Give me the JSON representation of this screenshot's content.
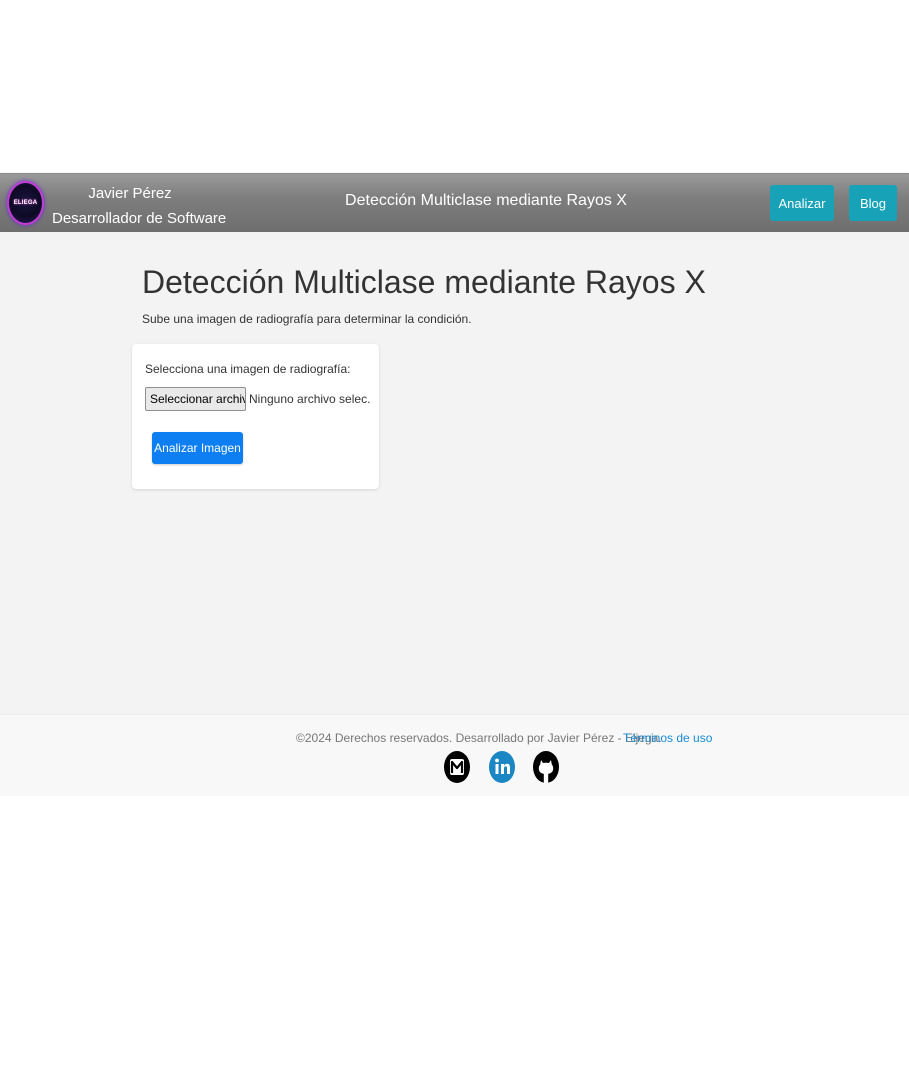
{
  "header": {
    "logo_text": "ELIEGA",
    "brand_name": "Javier Pérez",
    "brand_role": "Desarrollador de Software",
    "title": "Detección Multiclase mediante Rayos X",
    "buttons": {
      "analizar": "Analizar",
      "blog": "Blog"
    },
    "button_color": "#17a2b8"
  },
  "main": {
    "title": "Detección Multiclase mediante Rayos X",
    "subtitle": "Sube una imagen de radiografía para determinar la condición.",
    "form": {
      "label": "Selecciona una imagen de radiografía:",
      "file_button": "Seleccionar archivo",
      "file_status": "Ninguno archivo selec.",
      "submit": "Analizar Imagen",
      "submit_color": "#0d7ff2"
    }
  },
  "footer": {
    "copyright": "©2024 Derechos reservados. Desarrollado por Javier Pérez - Eljega.",
    "terms_link": "Términos de uso",
    "social": [
      {
        "icon": "mail-icon"
      },
      {
        "icon": "linkedin-icon"
      },
      {
        "icon": "github-icon"
      }
    ]
  }
}
